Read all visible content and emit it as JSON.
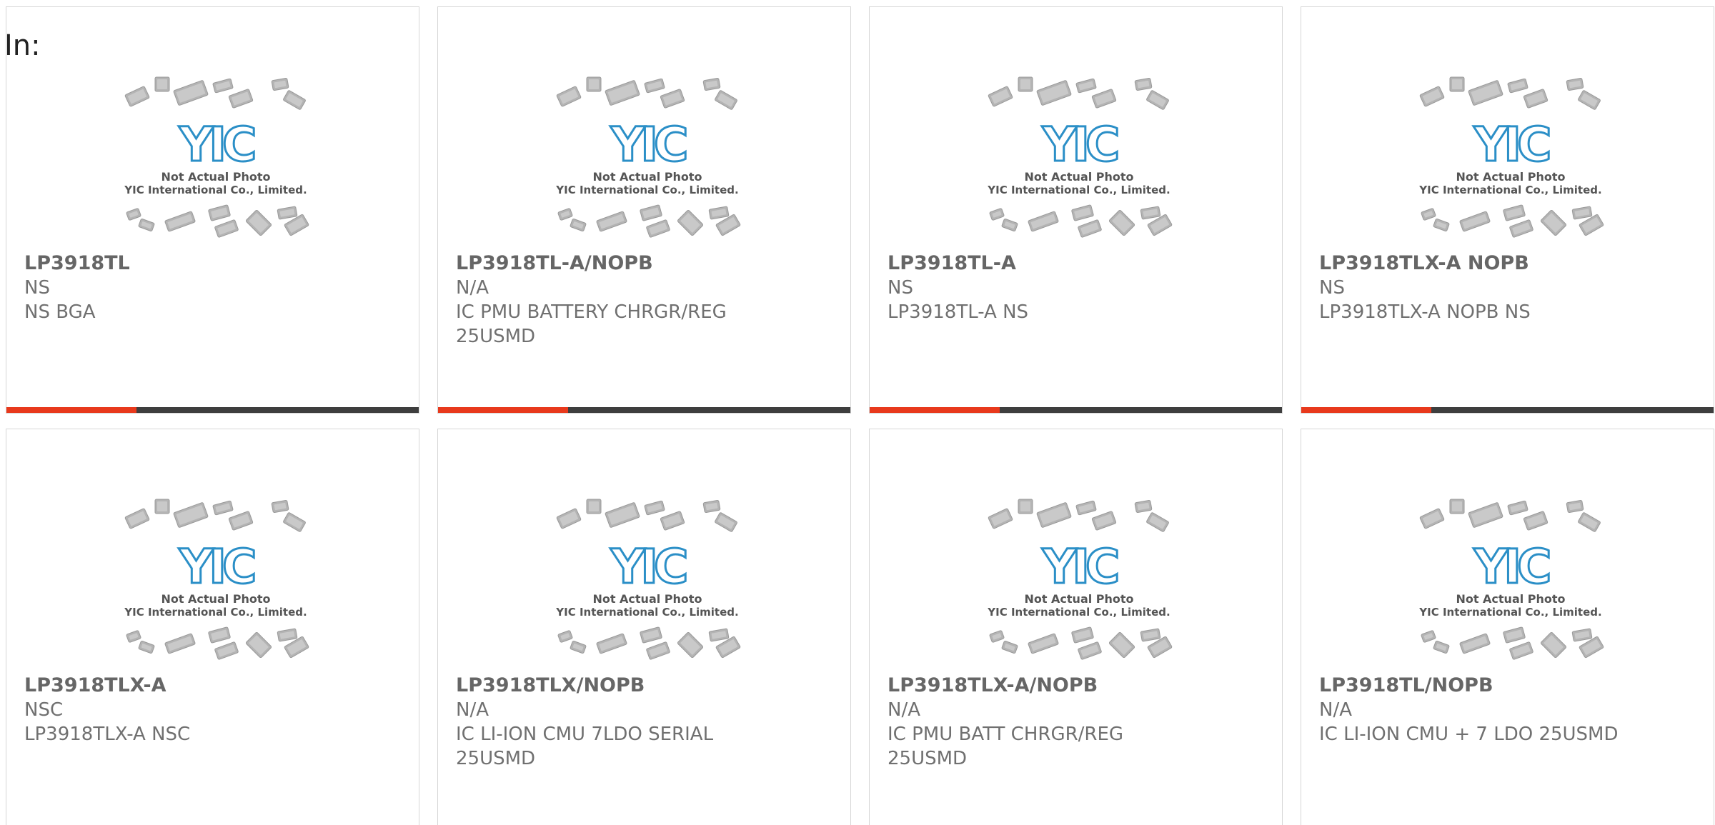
{
  "header": {
    "label": "In:"
  },
  "placeholder": {
    "line1": "Not Actual Photo",
    "line2": "YIC International Co., Limited.",
    "logo_text": "YIC"
  },
  "colors": {
    "accent": "#e8391c",
    "bar": "#3e3e3e",
    "logo": "#2b8fc7"
  },
  "products": [
    {
      "part": "LP3918TL",
      "mfr": "NS",
      "desc": "NS BGA"
    },
    {
      "part": "LP3918TL-A/NOPB",
      "mfr": "N/A",
      "desc": "IC PMU BATTERY CHRGR/REG 25USMD"
    },
    {
      "part": "LP3918TL-A",
      "mfr": "NS",
      "desc": "LP3918TL-A NS"
    },
    {
      "part": "LP3918TLX-A NOPB",
      "mfr": "NS",
      "desc": "LP3918TLX-A NOPB NS"
    },
    {
      "part": "LP3918TLX-A",
      "mfr": "NSC",
      "desc": "LP3918TLX-A NSC"
    },
    {
      "part": "LP3918TLX/NOPB",
      "mfr": "N/A",
      "desc": "IC LI-ION CMU 7LDO SERIAL 25USMD"
    },
    {
      "part": "LP3918TLX-A/NOPB",
      "mfr": "N/A",
      "desc": "IC PMU BATT CHRGR/REG 25USMD"
    },
    {
      "part": "LP3918TL/NOPB",
      "mfr": "N/A",
      "desc": "IC LI-ION CMU + 7 LDO 25USMD"
    }
  ]
}
